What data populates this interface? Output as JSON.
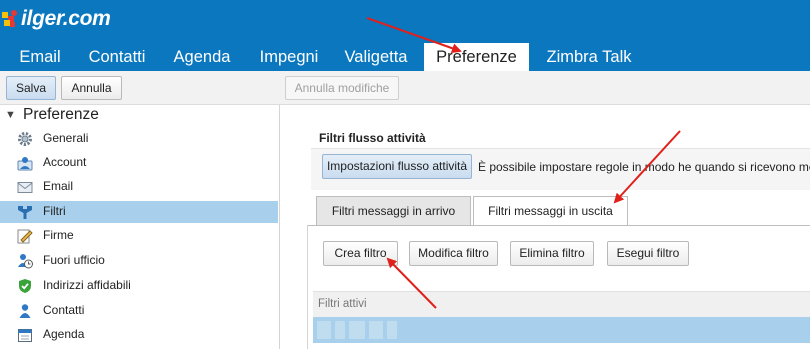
{
  "brand": {
    "logo_text": "ilger.com",
    "header_color": "#0a77bf"
  },
  "app_tabs": [
    {
      "label": "Email"
    },
    {
      "label": "Contatti"
    },
    {
      "label": "Agenda"
    },
    {
      "label": "Impegni"
    },
    {
      "label": "Valigetta"
    },
    {
      "label": "Preferenze",
      "active": true
    },
    {
      "label": "Zimbra Talk"
    }
  ],
  "toolbar": {
    "save_label": "Salva",
    "cancel_label": "Annulla",
    "undo_changes_label": "Annulla modifiche"
  },
  "sidebar": {
    "title": "Preferenze",
    "items": [
      {
        "label": "Generali",
        "icon": "gear-icon"
      },
      {
        "label": "Account",
        "icon": "account-icon"
      },
      {
        "label": "Email",
        "icon": "envelope-icon"
      },
      {
        "label": "Filtri",
        "icon": "filter-icon",
        "selected": true
      },
      {
        "label": "Firme",
        "icon": "signature-icon"
      },
      {
        "label": "Fuori ufficio",
        "icon": "out-of-office-icon"
      },
      {
        "label": "Indirizzi affidabili",
        "icon": "shield-check-icon"
      },
      {
        "label": "Contatti",
        "icon": "person-icon"
      },
      {
        "label": "Agenda",
        "icon": "calendar-icon"
      }
    ]
  },
  "main": {
    "section_title": "Filtri flusso attività",
    "flow_settings_button": "Impostazioni flusso attività",
    "flow_description": "È possibile impostare regole in modo he quando si ricevono me",
    "tabs": [
      {
        "label": "Filtri messaggi in arrivo"
      },
      {
        "label": "Filtri messaggi in uscita",
        "active": true
      }
    ],
    "filter_buttons": {
      "create": "Crea filtro",
      "edit": "Modifica filtro",
      "delete": "Elimina filtro",
      "run": "Esegui filtro"
    },
    "list_header": "Filtri attivi"
  },
  "colors": {
    "selection": "#a8d0ec",
    "annotation_arrow": "#e0201b"
  }
}
